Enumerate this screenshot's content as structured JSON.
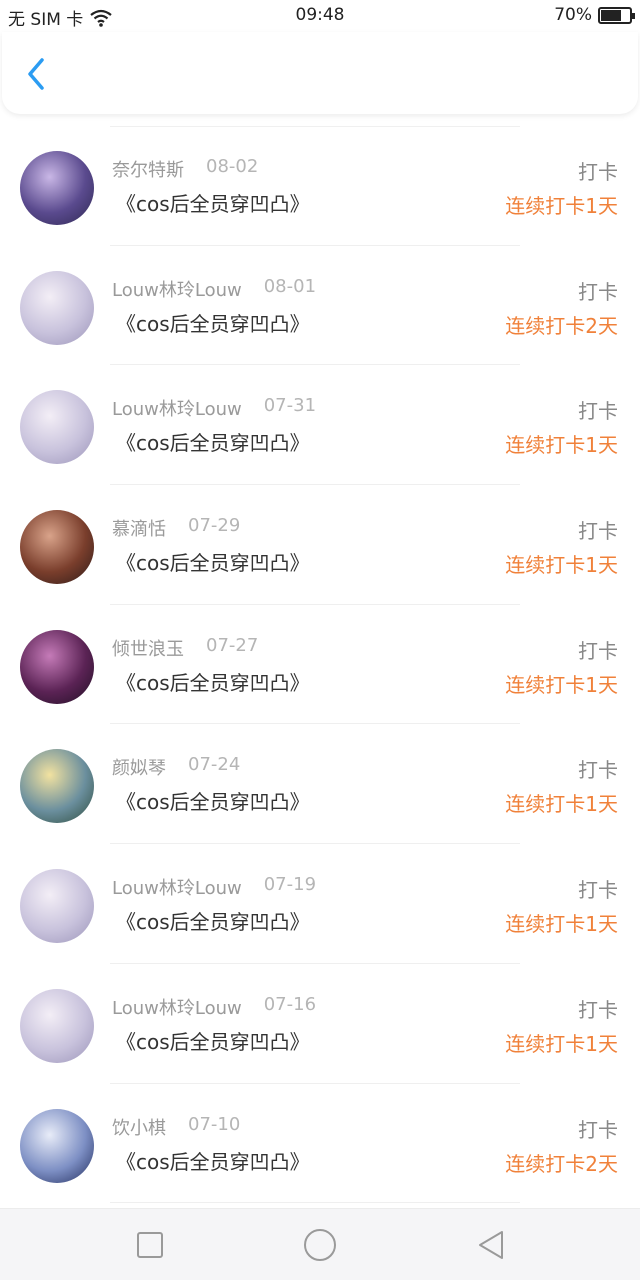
{
  "status": {
    "carrier": "无 SIM 卡",
    "time": "09:48",
    "battery_text": "70%",
    "battery_level": 0.7
  },
  "colors": {
    "accent": "#2b9cf2",
    "streak": "#f0813a"
  },
  "header": {
    "back_icon": "chevron-left-icon"
  },
  "items": [
    {
      "name": "奈尔特斯",
      "date": "08-02",
      "title": "《cos后全员穿凹凸》",
      "action": "打卡",
      "streak": "连续打卡1天",
      "avatar_colors": [
        "#c9b7e6",
        "#5a4a8e",
        "#2d2750"
      ]
    },
    {
      "name": "Louw林玲Louw",
      "date": "08-01",
      "title": "《cos后全员穿凹凸》",
      "action": "打卡",
      "streak": "连续打卡2天",
      "avatar_colors": [
        "#f3eef6",
        "#c8c2dc",
        "#9a93b8"
      ]
    },
    {
      "name": "Louw林玲Louw",
      "date": "07-31",
      "title": "《cos后全员穿凹凸》",
      "action": "打卡",
      "streak": "连续打卡1天",
      "avatar_colors": [
        "#f3eef6",
        "#c8c2dc",
        "#9a93b8"
      ]
    },
    {
      "name": "慕滴恬",
      "date": "07-29",
      "title": "《cos后全员穿凹凸》",
      "action": "打卡",
      "streak": "连续打卡1天",
      "avatar_colors": [
        "#d9a38a",
        "#7a3e2c",
        "#2b1a18"
      ]
    },
    {
      "name": "倾世浪玉",
      "date": "07-27",
      "title": "《cos后全员穿凹凸》",
      "action": "打卡",
      "streak": "连续打卡1天",
      "avatar_colors": [
        "#c57bb8",
        "#5b2355",
        "#1e0f22"
      ]
    },
    {
      "name": "颜姒琴",
      "date": "07-24",
      "title": "《cos后全员穿凹凸》",
      "action": "打卡",
      "streak": "连续打卡1天",
      "avatar_colors": [
        "#f2e2a0",
        "#6b8f9e",
        "#2c4a3a"
      ]
    },
    {
      "name": "Louw林玲Louw",
      "date": "07-19",
      "title": "《cos后全员穿凹凸》",
      "action": "打卡",
      "streak": "连续打卡1天",
      "avatar_colors": [
        "#f3eef6",
        "#c8c2dc",
        "#9a93b8"
      ]
    },
    {
      "name": "Louw林玲Louw",
      "date": "07-16",
      "title": "《cos后全员穿凹凸》",
      "action": "打卡",
      "streak": "连续打卡1天",
      "avatar_colors": [
        "#f3eef6",
        "#c8c2dc",
        "#9a93b8"
      ]
    },
    {
      "name": "饮小棋",
      "date": "07-10",
      "title": "《cos后全员穿凹凸》",
      "action": "打卡",
      "streak": "连续打卡2天",
      "avatar_colors": [
        "#e8ecf8",
        "#7d8fc4",
        "#1f2a5a"
      ]
    }
  ],
  "nav": {
    "recent_icon": "square-icon",
    "home_icon": "circle-icon",
    "back_icon": "triangle-back-icon"
  }
}
